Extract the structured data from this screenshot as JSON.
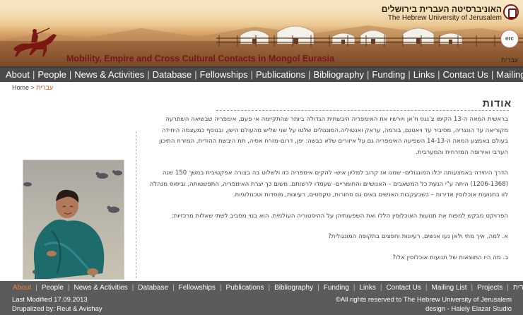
{
  "banner": {
    "title": "Mobility, Empire and Cross Cultural Contacts in Mongol Eurasia",
    "language_link": "עברית",
    "university_hebrew": "האוניברסיטה העברית בירושלים",
    "university_english": "The Hebrew University of Jerusalem",
    "erc_logo_text": "erc"
  },
  "topnav": {
    "items": [
      "About",
      "People",
      "News & Activities",
      "Database",
      "Fellowships",
      "Publications",
      "Bibliography",
      "Funding",
      "Links",
      "Contact Us",
      "Mailing List"
    ]
  },
  "breadcrumb": {
    "home": "Home",
    "separator": ">",
    "current": "עברית"
  },
  "content": {
    "title": "אודות",
    "paragraphs": [
      "בראשית המאה ה-13 הקימו צ'נגס ח'אן ויורשיו את האימפריה היבשתית הגדולה ביותר שהתקיימה אי פעם, אימפריה שבשיאה השתרעה מקוריאה עד הונגריה, מסיביר עד ויאטנם, בורמה, עראק ואנטוליה.המונגולים שלטו על שני שליש מהעולם הישן, ובנוסף כמעצמה היחידה בעולם באמצע המאה ה-14-13 השפיעה האימפריה גם על איזורים שלא כבשה: יפן, דרום-מזרח אסיה, תת היבשת ההודית, המזרח התיכון הערבי ואירופה המזרחית והמערבית.",
      "הדרך היחידה באמצעותה יכלו המונגולים- שמנו אז קרוב למליון איש- להקים אימפריה כזו ולשלוט בה בצורה אפקטיבית במשך 150 שנה (1206-1368) היתה ע\"י הנעת כל המשאבים – האנושיים והחומריים- שעמדו לרשותם. משום כך יצרת האימפריה, התפשטותה, וביסוס מנהלה לוו בתנועות אוכלוסין אדירות – כשבעקבות האנשים באים גם סחורות, טקסטים, רעיונות, מוסדות וטכנולוגיות.",
      "הפרויקט מבקש למפות את תנועות האוכלוסין הללו ואת השפעותיהן על ההיסטוריה העולמית. הוא בנוי מסביב לשתי שאלות מרכזיות:",
      "א. למה, איך מתי ולאן נעו אנשים, רעיונות וחפצים בתקופה המונגולית?",
      "ב. מה היו התוצאות של תנועות אוכלוסין אלו?"
    ]
  },
  "footer": {
    "nav": [
      "About",
      "People",
      "News & Activities",
      "Database",
      "Fellowships",
      "Publications",
      "Bibliography",
      "Funding",
      "Links",
      "Contact Us",
      "Mailing List",
      "Projects",
      "עברית"
    ],
    "last_modified": "Last Modified 17.09.2013",
    "drupalized": "Drupalized by: Reut & Avishay",
    "rights": "©All rights reserved to The Hebrew University of Jerusalem",
    "design": "design - Halely Elazar Studio"
  },
  "colors": {
    "banner_title": "#7a1712",
    "nav_bg": "#4a4a4a",
    "footer_bg": "#5b5b5b",
    "active_link": "#e7823a"
  }
}
